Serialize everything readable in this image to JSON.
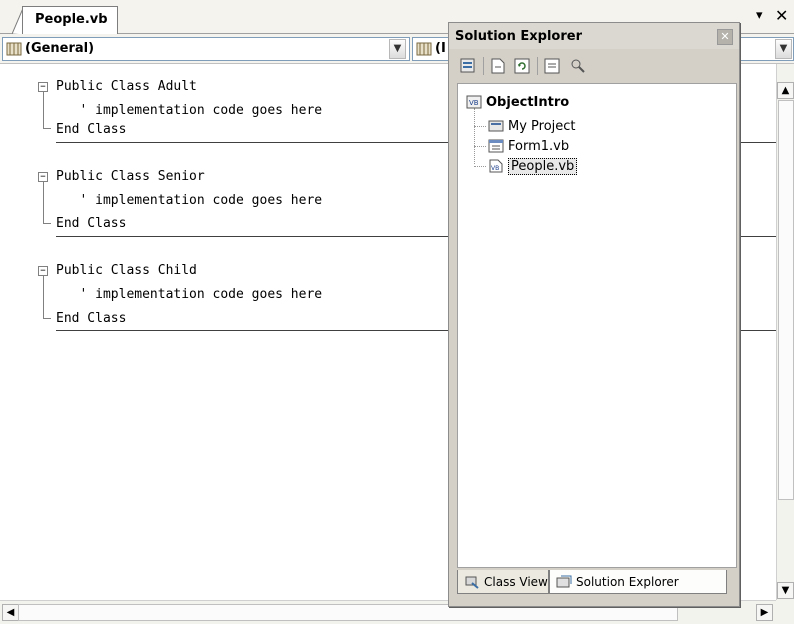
{
  "document_tab": {
    "label": "People.vb"
  },
  "tab_controls": {
    "menu_glyph": "▾",
    "close_glyph": "✕"
  },
  "navbar": {
    "left_combo": {
      "value": "(General)"
    },
    "right_combo": {
      "value": "(I"
    }
  },
  "code": {
    "lines": [
      "Public Class Adult",
      "   ' implementation code goes here",
      "End Class",
      "Public Class Senior",
      "   ' implementation code goes here",
      "End Class",
      "Public Class Child",
      "   ' implementation code goes here",
      "End Class"
    ]
  },
  "solution_explorer": {
    "title": "Solution Explorer",
    "toolbar_icons": [
      "properties-icon",
      "show-all-files-icon",
      "refresh-icon",
      "view-code-icon",
      "view-class-diagram-icon"
    ],
    "tree": {
      "root": "ObjectIntro",
      "items": [
        "My Project",
        "Form1.vb",
        "People.vb"
      ],
      "selected": "People.vb"
    },
    "tabs": [
      "Class View",
      "Solution Explorer"
    ],
    "active_tab": "Solution Explorer"
  },
  "colors": {
    "panel_bg": "#d4d0c8",
    "tab_strip_bg": "#f4f3ee",
    "code_text": "#000000",
    "separator": "#404040"
  }
}
